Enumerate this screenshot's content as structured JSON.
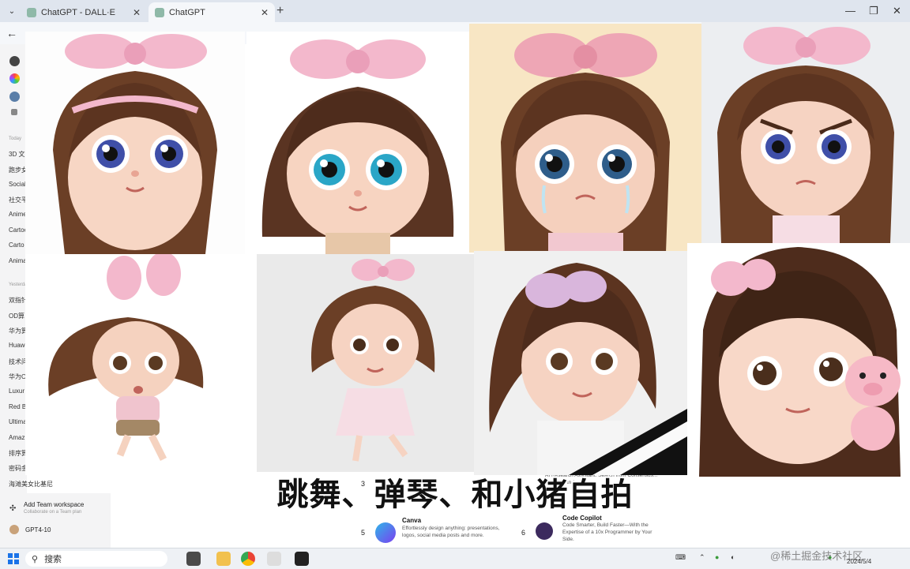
{
  "browser": {
    "tabs": [
      {
        "title": "ChatGPT - DALL·E",
        "active": false
      },
      {
        "title": "ChatGPT",
        "active": true
      }
    ],
    "new_tab_label": "+",
    "window_controls": {
      "minimize": "—",
      "maximize": "❐",
      "close": "✕"
    }
  },
  "sidebar": {
    "sections": [
      {
        "label": "Today",
        "items": [
          "3D 文",
          "跑步女",
          "Social",
          "社交平",
          "Anime",
          "Cartoo",
          "Carto",
          "Anima"
        ]
      },
      {
        "label": "Yesterday",
        "items": [
          "双指针",
          "OD算",
          "华为算",
          "Huawe",
          "技术问",
          "华为O",
          "Luxur",
          "Red B",
          "Ultima",
          "Amaz",
          "排序算",
          "密码金",
          "海滩美女比基尼"
        ]
      }
    ],
    "team": {
      "title": "Add Team workspace",
      "subtitle": "Collaborate on a Team plan"
    },
    "account": {
      "name": "GPT4-10"
    }
  },
  "images": [
    {
      "mood": "smile",
      "bg": "#fdfdfd"
    },
    {
      "mood": "smile",
      "bg": "#ffffff"
    },
    {
      "mood": "cry",
      "bg": "#f8e6c4"
    },
    {
      "mood": "angry",
      "bg": "#eceef1"
    },
    {
      "mood": "run",
      "bg": "#ffffff"
    },
    {
      "mood": "dance",
      "bg": "#eaeaea"
    },
    {
      "mood": "piano",
      "bg": "#f0f0f0"
    },
    {
      "mood": "pig",
      "bg": "#ffffff"
    }
  ],
  "gpt_cards": [
    {
      "num": "3",
      "title": "",
      "desc": "AI Research Assistant. Search from Consensus... answers and ..."
    },
    {
      "num": "5",
      "title": "Canva",
      "desc": "Effortlessly design anything: presentations, logos, social media posts and more.",
      "icon_color": "#2fb6e8"
    },
    {
      "num": "6",
      "title": "Code Copilot",
      "desc": "Code Smarter, Build Faster—With the Expertise of a 10x Programmer by Your Side.",
      "icon_color": "#3c2a5e"
    }
  ],
  "subtitle": "跳舞、弹琴、和小猪自拍",
  "taskbar": {
    "search_placeholder": "搜索",
    "watermark": "@稀土掘金技术社区",
    "date": "2024/5/4"
  },
  "colors": {
    "hair": "#6b3f26",
    "bow": "#f3b8cc",
    "skin": "#f7d6c4",
    "accent": "#1a73e8"
  }
}
